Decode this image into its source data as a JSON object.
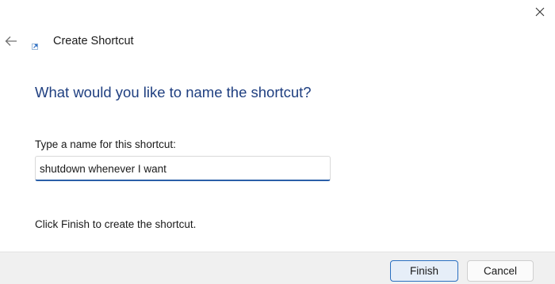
{
  "window": {
    "title": "Create Shortcut",
    "close_icon": "close-icon",
    "back_icon": "back-arrow-icon",
    "wizard_icon": "shortcut-icon"
  },
  "content": {
    "heading": "What would you like to name the shortcut?",
    "name_label": "Type a name for this shortcut:",
    "name_value": "shutdown whenever I want",
    "hint": "Click Finish to create the shortcut."
  },
  "footer": {
    "finish_label": "Finish",
    "cancel_label": "Cancel"
  },
  "colors": {
    "heading": "#1f3f80",
    "accent": "#2a5fa8",
    "footer_bg": "#f0f0f0"
  }
}
